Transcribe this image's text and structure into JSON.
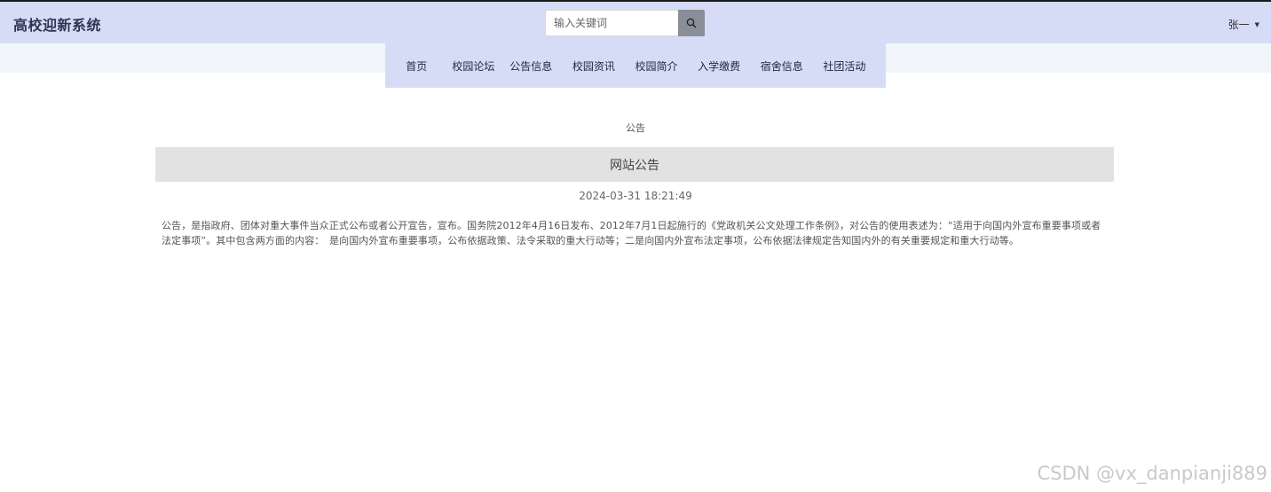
{
  "header": {
    "app_title": "高校迎新系统",
    "search": {
      "placeholder": "输入关键词",
      "value": ""
    },
    "user": {
      "name": "张一"
    }
  },
  "nav": {
    "items": [
      {
        "label": "首页"
      },
      {
        "label": "校园论坛"
      },
      {
        "label": "公告信息"
      },
      {
        "label": "校园资讯"
      },
      {
        "label": "校园简介"
      },
      {
        "label": "入学缴费"
      },
      {
        "label": "宿舍信息"
      },
      {
        "label": "社团活动"
      }
    ]
  },
  "main": {
    "section_label": "公告",
    "article": {
      "title": "网站公告",
      "date": "2024-03-31 18:21:49",
      "body": "公告，是指政府、团体对重大事件当众正式公布或者公开宣告，宣布。国务院2012年4月16日发布、2012年7月1日起施行的《党政机关公文处理工作条例》，对公告的使用表述为：“适用于向国内外宣布重要事项或者法定事项”。其中包含两方面的内容：　是向国内外宣布重要事项，公布依据政策、法令采取的重大行动等；二是向国内外宣布法定事项，公布依据法律规定告知国内外的有关重要规定和重大行动等。"
    }
  },
  "watermark": "CSDN @vx_danpianji889",
  "colors": {
    "header_bg": "#d6dcf5",
    "subband_bg": "#f2f6fa",
    "search_button_bg": "#8a8e99",
    "article_bar_bg": "#e2e2e2"
  },
  "icons": {
    "search": "search-icon",
    "user_caret": "caret-down-icon"
  }
}
